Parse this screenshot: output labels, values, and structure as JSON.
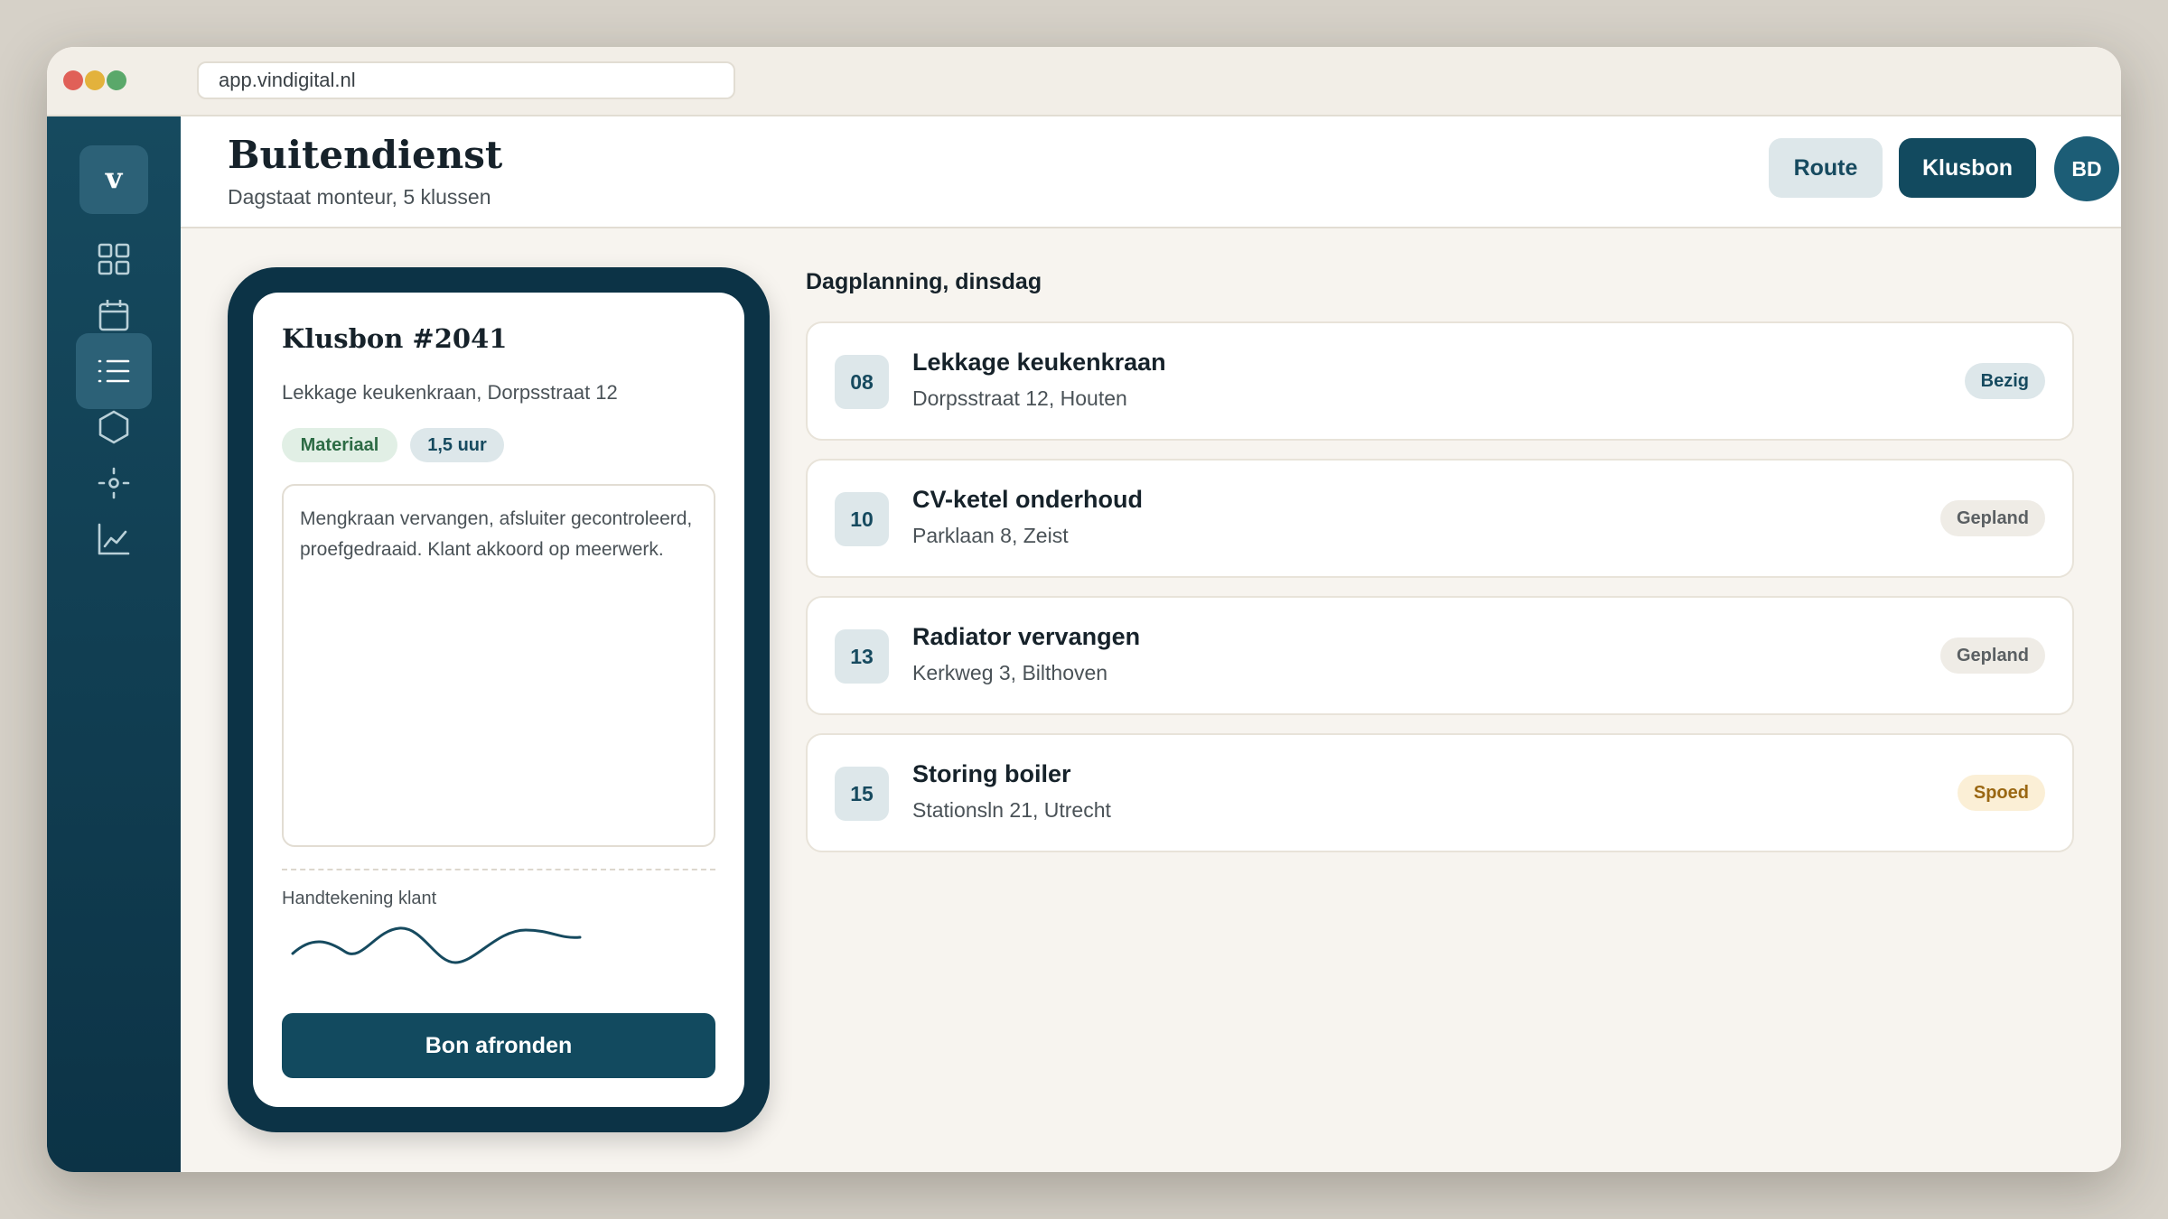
{
  "browser": {
    "url": "app.vindigital.nl"
  },
  "sidebar": {
    "logo": "v",
    "items": [
      {
        "icon": "grid-icon",
        "active": false
      },
      {
        "icon": "calendar-icon",
        "active": false
      },
      {
        "icon": "list-icon",
        "active": true
      },
      {
        "icon": "hexagon-icon",
        "active": false
      },
      {
        "icon": "location-icon",
        "active": false
      },
      {
        "icon": "chart-icon",
        "active": false
      }
    ]
  },
  "header": {
    "title": "Buitendienst",
    "subtitle": "Dagstaat monteur, 5 klussen",
    "route_label": "Route",
    "klusbon_label": "Klusbon",
    "avatar_initials": "BD"
  },
  "workorder": {
    "title": "Klusbon #2041",
    "subtitle": "Lekkage keukenkraan, Dorpsstraat 12",
    "tags": [
      "Materiaal",
      "1,5 uur"
    ],
    "note": "Mengkraan vervangen, afsluiter gecontroleerd, proefgedraaid. Klant akkoord op meerwerk.",
    "signature_label": "Handtekening klant",
    "finish_label": "Bon afronden"
  },
  "schedule": {
    "title": "Dagplanning, dinsdag",
    "jobs": [
      {
        "time": "08",
        "title": "Lekkage keukenkraan",
        "address": "Dorpsstraat 12, Houten",
        "status": "Bezig",
        "status_color": "#164a5f",
        "status_bg": "#dde7ea"
      },
      {
        "time": "10",
        "title": "CV-ketel onderhoud",
        "address": "Parklaan 8, Zeist",
        "status": "Gepland",
        "status_color": "#5a5f62",
        "status_bg": "#efece6"
      },
      {
        "time": "13",
        "title": "Radiator vervangen",
        "address": "Kerkweg 3, Bilthoven",
        "status": "Gepland",
        "status_color": "#5a5f62",
        "status_bg": "#efece6"
      },
      {
        "time": "15",
        "title": "Storing boiler",
        "address": "Stationsln 21, Utrecht",
        "status": "Spoed",
        "status_color": "#9a6712",
        "status_bg": "#fbefd6"
      }
    ]
  },
  "colors": {
    "primary": "#124a5f",
    "sidebar_dark": "#0c3346",
    "accent_soft": "#dde7ea"
  }
}
